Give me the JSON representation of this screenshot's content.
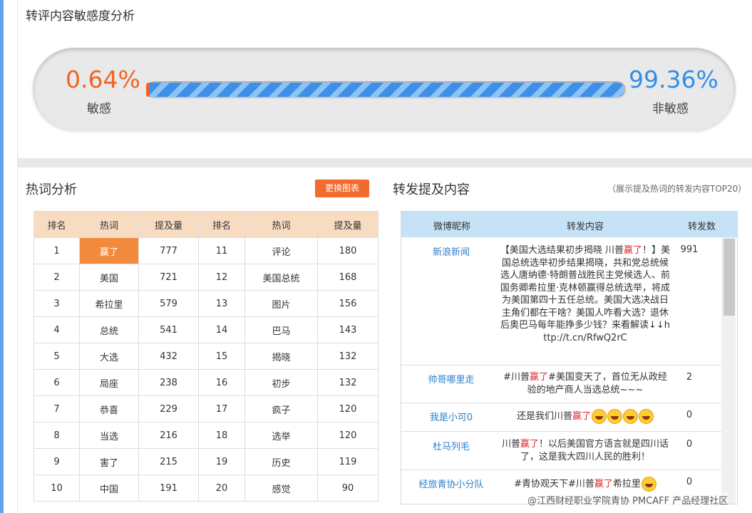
{
  "sensitivity": {
    "title": "转评内容敏感度分析",
    "sensitive_pct": "0.64%",
    "sensitive_label": "敏感",
    "non_sensitive_pct": "99.36%",
    "non_sensitive_label": "非敏感",
    "sensitive_fraction": 0.0064,
    "colors": {
      "sensitive": "#f26322",
      "non_sensitive": "#2e8fe8"
    }
  },
  "hotwords": {
    "title": "热词分析",
    "switch_button": "更换图表",
    "headers": [
      "排名",
      "热词",
      "提及量",
      "排名",
      "热词",
      "提及量"
    ],
    "rows": [
      {
        "r1": "1",
        "w1": "赢了",
        "c1": "777",
        "r2": "11",
        "w2": "评论",
        "c2": "180"
      },
      {
        "r1": "2",
        "w1": "美国",
        "c1": "721",
        "r2": "12",
        "w2": "美国总统",
        "c2": "168"
      },
      {
        "r1": "3",
        "w1": "希拉里",
        "c1": "579",
        "r2": "13",
        "w2": "图片",
        "c2": "156"
      },
      {
        "r1": "4",
        "w1": "总统",
        "c1": "541",
        "r2": "14",
        "w2": "巴马",
        "c2": "143"
      },
      {
        "r1": "5",
        "w1": "大选",
        "c1": "432",
        "r2": "15",
        "w2": "揭晓",
        "c2": "132"
      },
      {
        "r1": "6",
        "w1": "局座",
        "c1": "238",
        "r2": "16",
        "w2": "初步",
        "c2": "132"
      },
      {
        "r1": "7",
        "w1": "恭喜",
        "c1": "229",
        "r2": "17",
        "w2": "疯子",
        "c2": "120"
      },
      {
        "r1": "8",
        "w1": "当选",
        "c1": "216",
        "r2": "18",
        "w2": "选举",
        "c2": "120"
      },
      {
        "r1": "9",
        "w1": "害了",
        "c1": "215",
        "r2": "19",
        "w2": "历史",
        "c2": "119"
      },
      {
        "r1": "10",
        "w1": "中国",
        "c1": "191",
        "r2": "20",
        "w2": "感觉",
        "c2": "90"
      }
    ]
  },
  "reposts": {
    "title": "转发提及内容",
    "note": "（展示提及热词的转发内容TOP20）",
    "headers": {
      "nick": "微博昵称",
      "content": "转发内容",
      "count": "转发数"
    },
    "rows": [
      {
        "nick": "新浪新闻",
        "pre": "【美国大选结果初步揭晓 川普",
        "hl": "赢了",
        "post": "！】美国总统选举初步结果揭晓，共和党总统候选人唐纳德·特朗普战胜民主党候选人、前国务卿希拉里·克林顿赢得总统选举，将成为美国第四十五任总统。美国大选决战日主角们都在干啥？美国人咋看大选？退休后奥巴马每年能挣多少钱？来看解读↓↓http://t.cn/RfwQ2rC",
        "count": "991"
      },
      {
        "nick": "帅哥哪里走",
        "pre": "#川普",
        "hl": "赢了",
        "post": "#美国变天了，首位无从政经验的地产商人当选总统~~~",
        "count": "2"
      },
      {
        "nick": "我是小可0",
        "pre": "还是我们川普",
        "hl": "赢了",
        "post": "",
        "count": "0"
      },
      {
        "nick": "杜马列毛",
        "pre": "川普",
        "hl": "赢了",
        "post": "！以后美国官方语言就是四川话了，这是我大四川人民的胜利！",
        "count": "0"
      },
      {
        "nick": "经旅青协小分队",
        "pre": "#青协观天下#川普",
        "hl": "赢了",
        "post": "希拉里",
        "count": "0"
      }
    ]
  },
  "watermark": "@江西财经职业学院青协 PMCAFF 产品经理社区"
}
